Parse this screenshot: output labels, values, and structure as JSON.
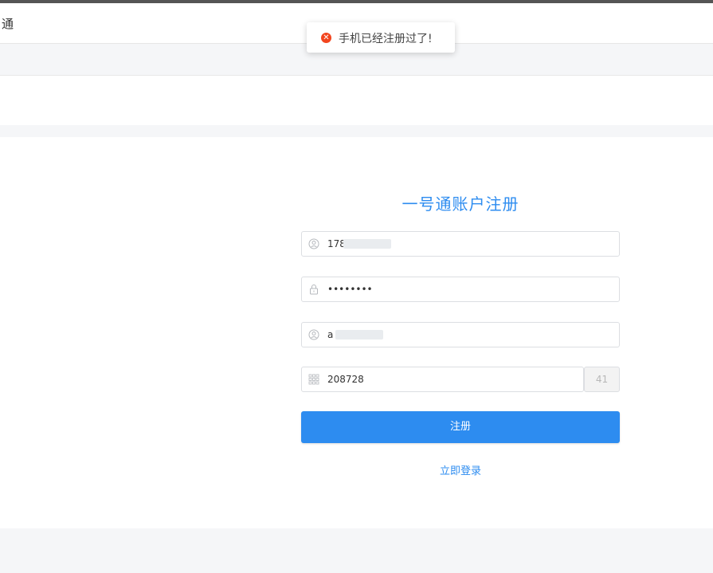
{
  "header": {
    "brand": "号通"
  },
  "toast": {
    "type": "error",
    "message": "手机已经注册过了!"
  },
  "form": {
    "title": "一号通账户注册",
    "phone": {
      "value": "178",
      "icon": "user-icon"
    },
    "password": {
      "value": "••••••••",
      "icon": "lock-icon"
    },
    "email": {
      "value": "a",
      "icon": "user-icon"
    },
    "captcha": {
      "value": "208728",
      "icon": "grid-icon"
    },
    "countdown": "41",
    "submit_label": "注册",
    "login_link": "立即登录"
  },
  "colors": {
    "accent": "#2d8cf0",
    "error": "#f2451e"
  }
}
